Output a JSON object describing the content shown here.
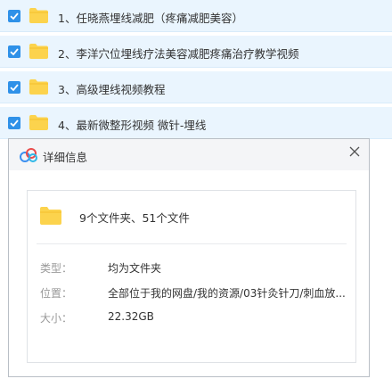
{
  "file_list": {
    "items": [
      {
        "label": "1、任晓燕埋线减肥（疼痛减肥美容）",
        "checked": true
      },
      {
        "label": "2、李洋穴位埋线疗法美容减肥疼痛治疗教学视频",
        "checked": true
      },
      {
        "label": "3、高级埋线视频教程",
        "checked": true
      },
      {
        "label": "4、最新微整形视频 微针-埋线",
        "checked": true
      }
    ]
  },
  "dialog": {
    "title": "详细信息",
    "close_icon": "close-icon",
    "summary": "9个文件夹、51个文件",
    "type_label": "类型：",
    "type_value": "均为文件夹",
    "location_label": "位置：",
    "location_value": "全部位于我的网盘/我的资源/03针灸针刀/刺血放...",
    "size_label": "大小：",
    "size_value": "22.32GB"
  },
  "colors": {
    "row_bg": "#eaf5fe",
    "checkbox": "#2f91e8",
    "folder": "#fcd34d"
  }
}
